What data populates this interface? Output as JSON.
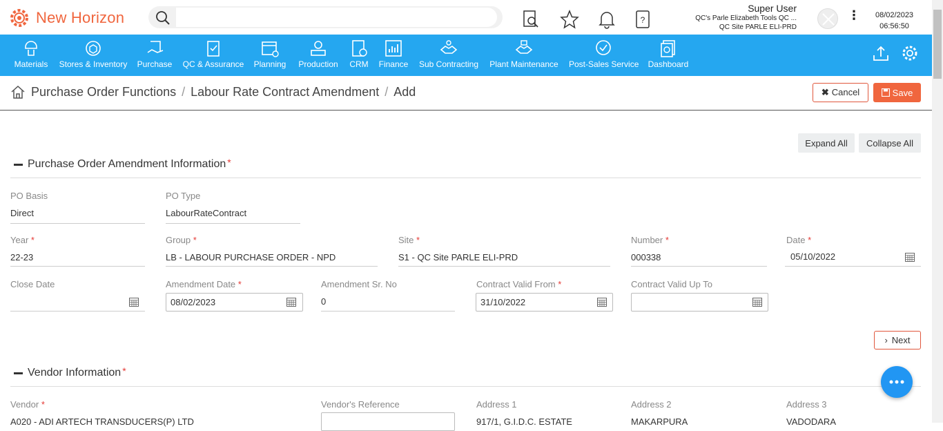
{
  "app": {
    "title": "New Horizon"
  },
  "search": {
    "placeholder": ""
  },
  "user": {
    "name": "Super User",
    "company": "QC's Parle Elizabeth Tools QC ...",
    "site": "QC Site PARLE ELI-PRD",
    "date": "08/02/2023",
    "time": "06:56:50"
  },
  "nav": {
    "items": [
      {
        "label": "Materials",
        "icon": "materials-icon"
      },
      {
        "label": "Stores & Inventory",
        "icon": "stores-icon"
      },
      {
        "label": "Purchase",
        "icon": "purchase-icon"
      },
      {
        "label": "QC & Assurance",
        "icon": "qc-icon"
      },
      {
        "label": "Planning",
        "icon": "planning-icon"
      },
      {
        "label": "Production",
        "icon": "production-icon"
      },
      {
        "label": "CRM",
        "icon": "crm-icon"
      },
      {
        "label": "Finance",
        "icon": "finance-icon"
      },
      {
        "label": "Sub Contracting",
        "icon": "subcontracting-icon"
      },
      {
        "label": "Plant Maintenance",
        "icon": "maintenance-icon"
      },
      {
        "label": "Post-Sales Service",
        "icon": "post-sales-icon"
      },
      {
        "label": "Dashboard",
        "icon": "dashboard-icon"
      }
    ]
  },
  "breadcrumb": {
    "items": [
      "Purchase Order Functions",
      "Labour Rate Contract Amendment",
      "Add"
    ],
    "separator": "/"
  },
  "actions": {
    "cancel": "Cancel",
    "save": "Save",
    "expand_all": "Expand All",
    "collapse_all": "Collapse All",
    "next": "Next"
  },
  "section1": {
    "title": "Purchase Order Amendment Information",
    "required_mark": "*",
    "po_basis": {
      "label": "PO Basis",
      "value": "Direct"
    },
    "po_type": {
      "label": "PO Type",
      "value": "LabourRateContract"
    },
    "year": {
      "label": "Year",
      "value": "22-23"
    },
    "group": {
      "label": "Group",
      "value": "LB - LABOUR PURCHASE ORDER - NPD"
    },
    "site": {
      "label": "Site",
      "value": "S1 - QC Site PARLE ELI-PRD"
    },
    "number": {
      "label": "Number",
      "value": "000338"
    },
    "date": {
      "label": "Date",
      "value": "05/10/2022"
    },
    "close_date": {
      "label": "Close Date",
      "value": ""
    },
    "amendment_date": {
      "label": "Amendment Date",
      "value": "08/02/2023"
    },
    "amendment_sr_no": {
      "label": "Amendment Sr. No",
      "value": "0"
    },
    "contract_valid_from": {
      "label": "Contract Valid From",
      "value": "31/10/2022"
    },
    "contract_valid_up_to": {
      "label": "Contract Valid Up To",
      "value": ""
    }
  },
  "section2": {
    "title": "Vendor Information",
    "required_mark": "*",
    "vendor": {
      "label": "Vendor",
      "value": "A020 - ADI ARTECH TRANSDUCERS(P) LTD"
    },
    "vendor_reference": {
      "label": "Vendor's Reference",
      "value": ""
    },
    "address1": {
      "label": "Address 1",
      "value": "917/1, G.I.D.C. ESTATE"
    },
    "address2": {
      "label": "Address 2",
      "value": "MAKARPURA"
    },
    "address3": {
      "label": "Address 3",
      "value": "VADODARA"
    }
  },
  "colors": {
    "brand": "#f0663e",
    "nav": "#25a7f0",
    "required": "#e53935",
    "chat": "#2196f3"
  }
}
